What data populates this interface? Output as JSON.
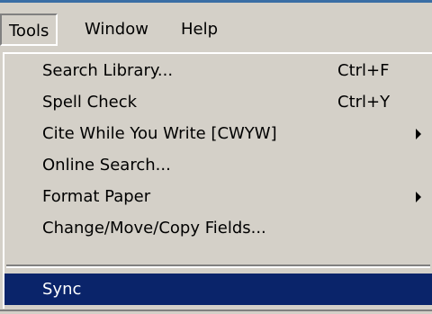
{
  "menubar": {
    "items": [
      {
        "label": "Tools",
        "active": true
      },
      {
        "label": "Window",
        "active": false
      },
      {
        "label": "Help",
        "active": false
      }
    ]
  },
  "tools_menu": {
    "items": [
      {
        "label": "Search Library...",
        "shortcut": "Ctrl+F"
      },
      {
        "label": "Spell Check",
        "shortcut": "Ctrl+Y"
      },
      {
        "label": "Cite While You Write [CWYW]",
        "submenu": true
      },
      {
        "label": "Online Search..."
      },
      {
        "label": "Format Paper",
        "submenu": true
      },
      {
        "label": "Change/Move/Copy Fields..."
      },
      {
        "label": "Sync",
        "highlighted": true
      }
    ]
  },
  "colors": {
    "menu_background": "#d4d0c8",
    "highlight_background": "#0a246a",
    "highlight_text": "#ffffff",
    "window_frame": "#3a6ea5"
  }
}
